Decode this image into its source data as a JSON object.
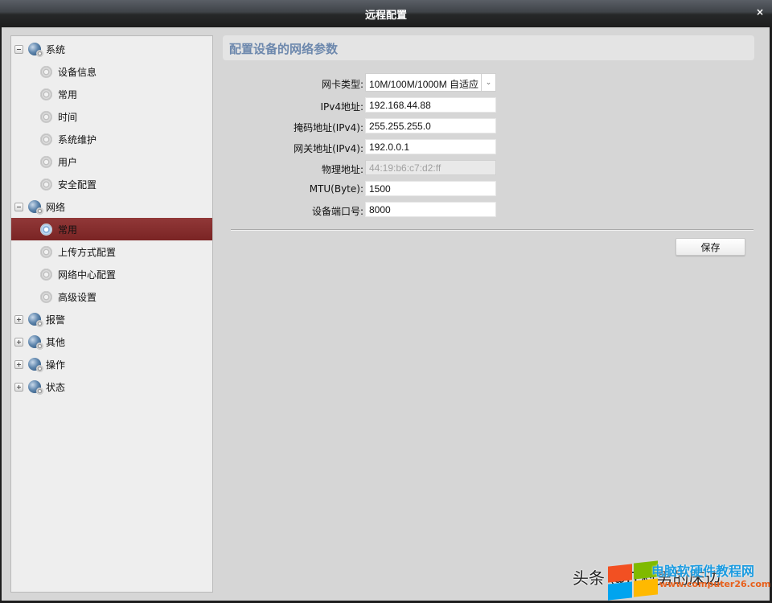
{
  "window": {
    "title": "远程配置",
    "close_label": "×"
  },
  "tree": {
    "groups": [
      {
        "label": "系统",
        "expanded": true,
        "toggle": "−",
        "items": [
          {
            "label": "设备信息"
          },
          {
            "label": "常用"
          },
          {
            "label": "时间"
          },
          {
            "label": "系统维护"
          },
          {
            "label": "用户"
          },
          {
            "label": "安全配置"
          }
        ]
      },
      {
        "label": "网络",
        "expanded": true,
        "toggle": "−",
        "items": [
          {
            "label": "常用",
            "selected": true
          },
          {
            "label": "上传方式配置"
          },
          {
            "label": "网络中心配置"
          },
          {
            "label": "高级设置"
          }
        ]
      },
      {
        "label": "报警",
        "expanded": false,
        "toggle": "+"
      },
      {
        "label": "其他",
        "expanded": false,
        "toggle": "+"
      },
      {
        "label": "操作",
        "expanded": false,
        "toggle": "+"
      },
      {
        "label": "状态",
        "expanded": false,
        "toggle": "+"
      }
    ],
    "selected_color": "#862e2e"
  },
  "main": {
    "header_title": "配置设备的网络参数",
    "header_color": "#6d88ad",
    "fields": {
      "nic_type": {
        "label": "网卡类型:",
        "value": "10M/100M/1000M 自适应"
      },
      "ipv4": {
        "label": "IPv4地址:",
        "value": "192.168.44.88"
      },
      "mask": {
        "label": "掩码地址(IPv4):",
        "value": "255.255.255.0"
      },
      "gateway": {
        "label": "网关地址(IPv4):",
        "value": "192.0.0.1"
      },
      "mac": {
        "label": "物理地址:",
        "value": "44:19:b6:c7:d2:ff",
        "disabled": true
      },
      "mtu": {
        "label": "MTU(Byte):",
        "value": "1500"
      },
      "port": {
        "label": "设备端口号:",
        "value": "8000"
      }
    },
    "save_label": "保存"
  },
  "watermark": {
    "left_text": "头条 @IT科男的床边",
    "site_cn": "电脑软硬件教程网",
    "site_url": "www.computer26.com"
  }
}
